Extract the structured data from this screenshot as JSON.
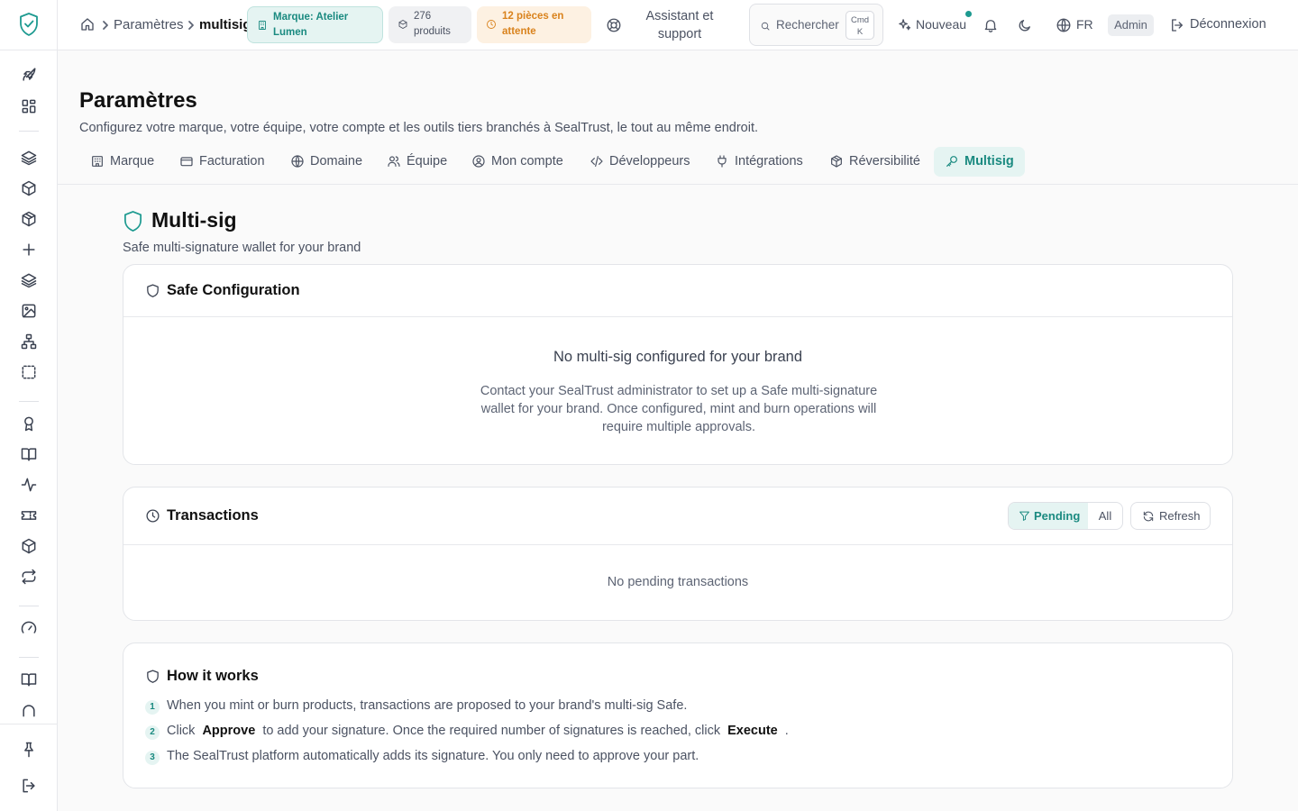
{
  "header": {
    "breadcrumb": {
      "parent": "Paramètres",
      "current": "multisig"
    },
    "brand_pill": "Marque: Atelier Lumen",
    "products_pill": "276 produits",
    "waiting_pill": "12 pièces en attente",
    "help": "Assistant et support",
    "search": {
      "placeholder": "Rechercher",
      "shortcut_key1": "Cmd",
      "shortcut_key2": "K"
    },
    "new_label": "Nouveau",
    "language": "FR",
    "role_badge": "Admin",
    "logout": "Déconnexion"
  },
  "page": {
    "title": "Paramètres",
    "subtitle": "Configurez votre marque, votre équipe, votre compte et les outils tiers branchés à SealTrust, le tout au même endroit.",
    "tabs": [
      {
        "label": "Marque",
        "icon": "building-icon"
      },
      {
        "label": "Facturation",
        "icon": "credit-card-icon"
      },
      {
        "label": "Domaine",
        "icon": "globe-icon"
      },
      {
        "label": "Équipe",
        "icon": "users-icon"
      },
      {
        "label": "Mon compte",
        "icon": "user-circle-icon"
      },
      {
        "label": "Développeurs",
        "icon": "code-icon"
      },
      {
        "label": "Intégrations",
        "icon": "plug-icon"
      },
      {
        "label": "Réversibilité",
        "icon": "package-icon"
      },
      {
        "label": "Multisig",
        "icon": "key-icon",
        "active": true
      }
    ]
  },
  "multisig": {
    "title": "Multi-sig",
    "subtitle": "Safe multi-signature wallet for your brand",
    "config_card": {
      "title": "Safe Configuration",
      "empty_title": "No multi-sig configured for your brand",
      "empty_text": "Contact your SealTrust administrator to set up a Safe multi-signature wallet for your brand. Once configured, mint and burn operations will require multiple approvals."
    },
    "transactions_card": {
      "title": "Transactions",
      "filter_pending": "Pending",
      "filter_all": "All",
      "refresh": "Refresh",
      "empty": "No pending transactions"
    },
    "how_card": {
      "title": "How it works",
      "step1_num": "1",
      "step1_text": "When you mint or burn products, transactions are proposed to your brand's multi-sig Safe.",
      "step2_num": "2",
      "step2_a": "Click",
      "step2_approve": "Approve",
      "step2_b": "to add your signature. Once the required number of signatures is reached, click",
      "step2_execute": "Execute",
      "step2_c": ".",
      "step3_num": "3",
      "step3_text": "The SealTrust platform automatically adds its signature. You only need to approve your part."
    }
  },
  "colors": {
    "accent": "#1d9a90",
    "accent_bg": "#e5f4f2",
    "warning": "#d9821c",
    "warning_bg": "#fdf1e2"
  },
  "sidebar_icons": [
    "shield-check-icon",
    "rocket-icon",
    "dashboard-icon",
    "layers-icon",
    "box-icon",
    "box-icon",
    "plus-icon",
    "layers-icon",
    "image-icon",
    "sitemap-icon",
    "dashed-square-icon",
    "award-icon",
    "book-icon",
    "activity-icon",
    "ticket-icon",
    "package-icon",
    "repeat-icon",
    "gauge-icon",
    "book-icon",
    "arch-icon",
    "pin-icon",
    "logout-icon"
  ]
}
